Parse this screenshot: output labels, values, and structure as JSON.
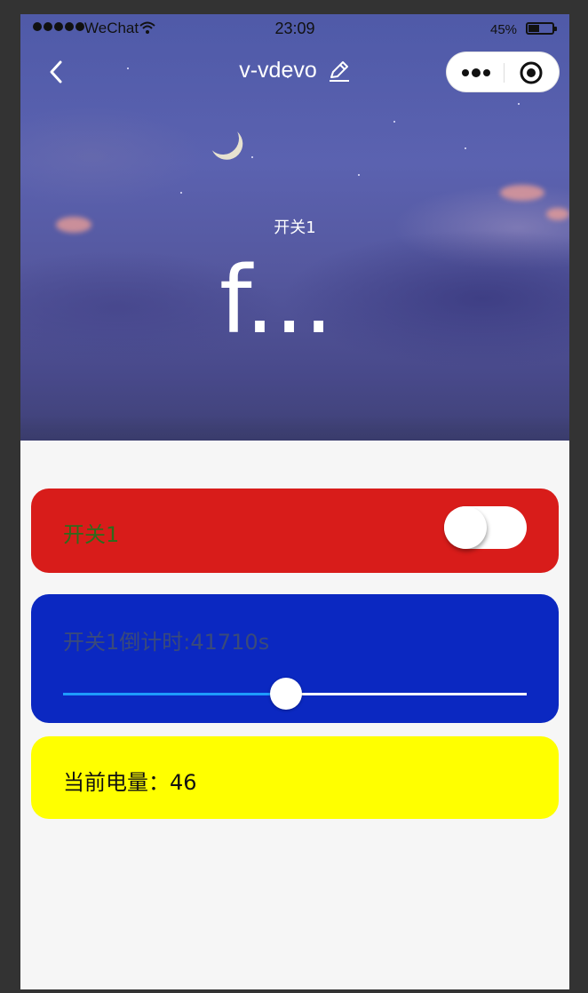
{
  "statusbar": {
    "carrier": "WeChat",
    "time": "23:09",
    "battery_pct": "45%",
    "battery_level": 0.45
  },
  "navbar": {
    "title": "v-vdevo"
  },
  "hero": {
    "label": "开关1",
    "value": "f..."
  },
  "switch_card": {
    "label": "开关1",
    "state": "off",
    "color": "#d81c1a"
  },
  "countdown_card": {
    "label": "开关1倒计时:41710s",
    "slider_fraction": 0.48,
    "color": "#0b28c1"
  },
  "battery_card": {
    "label": "当前电量：46",
    "color": "#ffff00"
  },
  "icons": [
    "back-icon",
    "edit-icon",
    "more-icon",
    "close-mini-program-icon",
    "wifi-icon",
    "battery-icon"
  ]
}
